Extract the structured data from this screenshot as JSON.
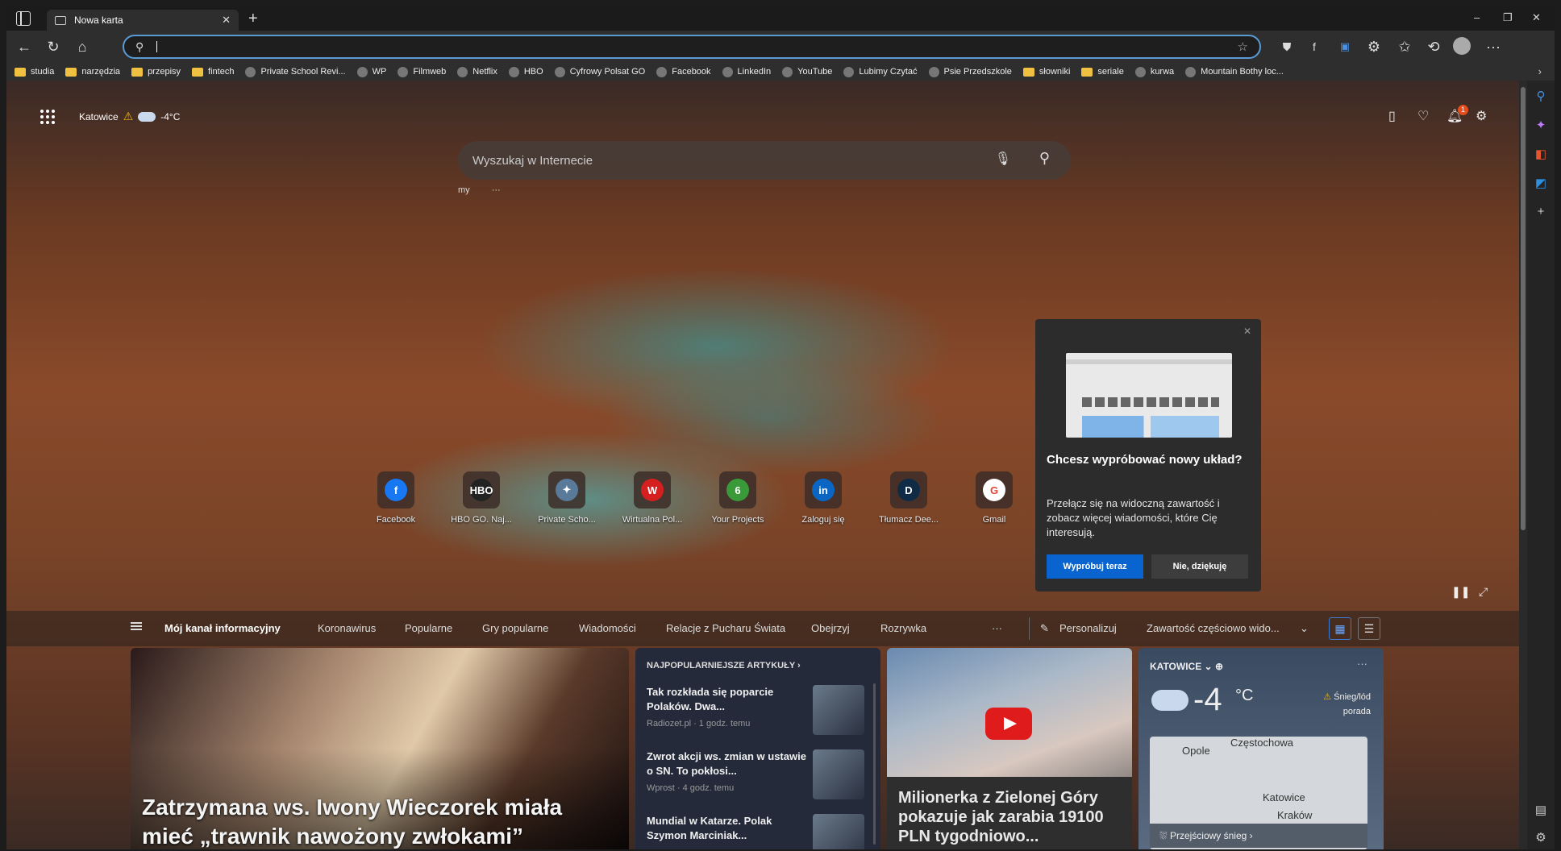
{
  "browser": {
    "tab_title": "Nowa karta",
    "address_value": "",
    "window_controls": [
      "–",
      "❐",
      "✕"
    ]
  },
  "bookmarks": [
    {
      "label": "studia",
      "kind": "folder"
    },
    {
      "label": "narzędzia",
      "kind": "folder"
    },
    {
      "label": "przepisy",
      "kind": "folder"
    },
    {
      "label": "fintech",
      "kind": "folder"
    },
    {
      "label": "Private School Revi...",
      "kind": "site"
    },
    {
      "label": "WP",
      "kind": "site"
    },
    {
      "label": "Filmweb",
      "kind": "site"
    },
    {
      "label": "Netflix",
      "kind": "site"
    },
    {
      "label": "HBO",
      "kind": "site"
    },
    {
      "label": "Cyfrowy Polsat GO",
      "kind": "site"
    },
    {
      "label": "Facebook",
      "kind": "site"
    },
    {
      "label": "LinkedIn",
      "kind": "site"
    },
    {
      "label": "YouTube",
      "kind": "site"
    },
    {
      "label": "Lubimy Czytać",
      "kind": "site"
    },
    {
      "label": "Psie Przedszkole",
      "kind": "site"
    },
    {
      "label": "słowniki",
      "kind": "folder"
    },
    {
      "label": "seriale",
      "kind": "folder"
    },
    {
      "label": "kurwa",
      "kind": "site"
    },
    {
      "label": "Mountain Bothy loc...",
      "kind": "site"
    }
  ],
  "newtab": {
    "weather_city": "Katowice",
    "weather_temp": "-4°C",
    "notif_count": "1",
    "search_placeholder": "Wyszukaj w Internecie",
    "under_search_label": "my",
    "under_search_more": "···"
  },
  "quick_links": [
    {
      "label": "Facebook",
      "glyph": "f",
      "color": "#1877f2"
    },
    {
      "label": "HBO GO. Naj...",
      "glyph": "HBO",
      "color": "#222222"
    },
    {
      "label": "Private Scho...",
      "glyph": "✦",
      "color": "#5a7a9a"
    },
    {
      "label": "Wirtualna Pol...",
      "glyph": "W",
      "color": "#d61f1f"
    },
    {
      "label": "Your Projects",
      "glyph": "6",
      "color": "#3a9a3a"
    },
    {
      "label": "Zaloguj się",
      "glyph": "in",
      "color": "#0a66c2"
    },
    {
      "label": "Tłumacz Dee...",
      "glyph": "D",
      "color": "#0f2b46"
    },
    {
      "label": "Gmail",
      "glyph": "G",
      "color": "#ffffff"
    }
  ],
  "popup": {
    "title": "Chcesz wypróbować nowy układ?",
    "body": "Przełącz się na widoczną zawartość i zobacz więcej wiadomości, które Cię interesują.",
    "primary": "Wypróbuj teraz",
    "secondary": "Nie, dziękuję"
  },
  "feed_nav": {
    "items": [
      "Mój kanał informacyjny",
      "Koronawirus",
      "Popularne",
      "Gry popularne",
      "Wiadomości",
      "Relacje z Pucharu Świata",
      "Obejrzyj",
      "Rozrywka"
    ],
    "more": "···",
    "personalize": "Personalizuj",
    "content_mode": "Zawartość częściowo wido..."
  },
  "hero": {
    "headline": "Zatrzymana ws. Iwony Wieczorek miała mieć „trawnik nawożony zwłokami”"
  },
  "popular": {
    "header": "NAJPOPULARNIEJSZE ARTYKUŁY",
    "articles": [
      {
        "title": "Tak rozkłada się poparcie Polaków. Dwa...",
        "source": "Radiozet.pl · 1 godz. temu"
      },
      {
        "title": "Zwrot akcji ws. zmian w ustawie o SN. To pokłosi...",
        "source": "Wprost · 4 godz. temu"
      },
      {
        "title": "Mundial w Katarze. Polak Szymon Marciniak...",
        "source": ""
      }
    ]
  },
  "video": {
    "headline": "Milionerka z Zielonej Góry pokazuje jak zarabia 19100 PLN tygodniowo..."
  },
  "weather_card": {
    "city": "KATOWICE",
    "temp": "-4",
    "unit": "°C",
    "condition": "Śnieg/lód",
    "tip": "porada",
    "map_labels": [
      "Opole",
      "Częstochowa",
      "Katowice",
      "Kraków"
    ],
    "forecast": "Przejściowy śnieg"
  }
}
